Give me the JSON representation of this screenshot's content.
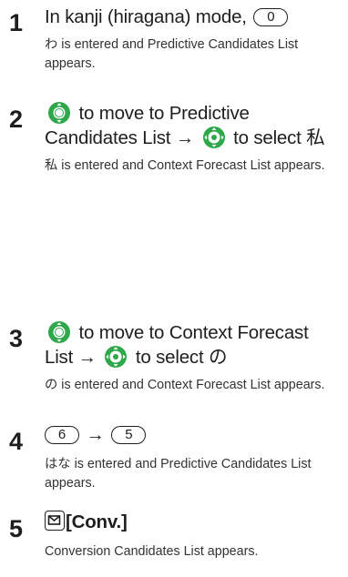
{
  "steps": [
    {
      "number": "1",
      "head_text": "In kanji (hiragana) mode,",
      "key": "0",
      "desc": "わ is entered and Predictive Candidates List appears."
    },
    {
      "number": "2",
      "head_part1": "to move to Predictive Candidates List",
      "arrow": "→",
      "head_part2": "to select 私",
      "desc": "私 is entered and Context Forecast List appears."
    },
    {
      "number": "3",
      "head_part1": "to move to Context Forecast List",
      "arrow": "→",
      "head_part2": "to select の",
      "desc": "の is entered and Context Forecast List appears."
    },
    {
      "number": "4",
      "key1": "6",
      "arrow": "→",
      "key2": "5",
      "desc": "はな is entered and Predictive Candidates List appears."
    },
    {
      "number": "5",
      "head_text": "[Conv.]",
      "desc": "Conversion Candidates List appears."
    }
  ],
  "icons": {
    "nav_vertical": "nav-key-up-down-icon",
    "nav_center": "nav-key-center-icon",
    "mail": "mail-key-icon"
  },
  "colors": {
    "nav_green": "#2ea84a",
    "text": "#1e1e1e"
  }
}
